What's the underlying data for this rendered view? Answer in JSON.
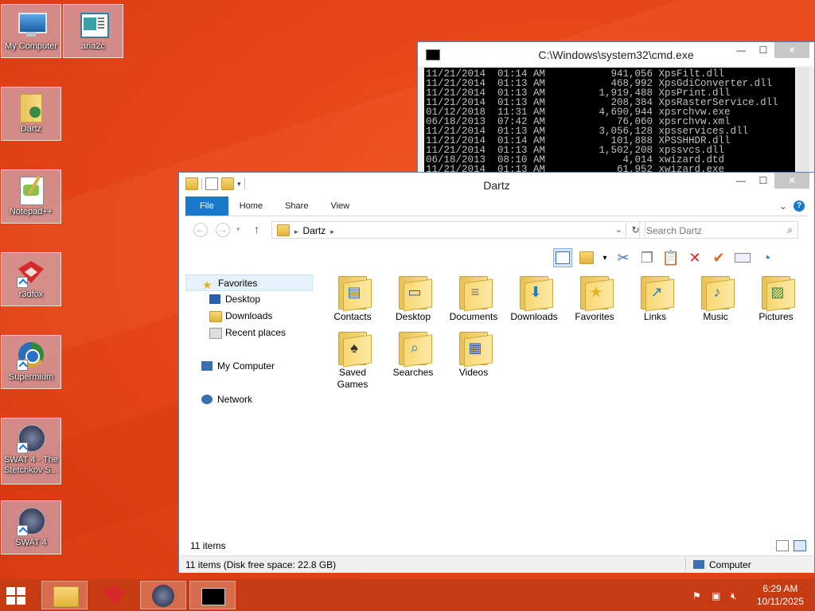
{
  "desktop": {
    "icons": [
      {
        "label": "My Computer"
      },
      {
        "label": "aria2c"
      },
      {
        "label": "Dartz"
      },
      {
        "label": "Notepad++"
      },
      {
        "label": "r3dfox"
      },
      {
        "label": "Supermium"
      },
      {
        "label": "SWAT 4 - The Stetchkov S..."
      },
      {
        "label": "SWAT 4"
      }
    ]
  },
  "cmd": {
    "title": "C:\\Windows\\system32\\cmd.exe",
    "lines": [
      "11/21/2014  01:14 AM           941,056 XpsFilt.dll",
      "11/21/2014  01:13 AM           468,992 XpsGdiConverter.dll",
      "11/21/2014  01:13 AM         1,919,488 XpsPrint.dll",
      "11/21/2014  01:13 AM           208,384 XpsRasterService.dll",
      "01/12/2018  11:31 AM         4,690,944 xpsrchvw.exe",
      "06/18/2013  07:42 AM            76,060 xpsrchvw.xml",
      "11/21/2014  01:13 AM         3,056,128 xpsservices.dll",
      "11/21/2014  01:14 AM           101,888 XPSSHHDR.dll",
      "11/21/2014  01:13 AM         1,502,208 xpssvcs.dll",
      "06/18/2013  08:10 AM             4,014 xwizard.dtd",
      "11/21/2014  01:13 AM            61,952 xwizard.exe"
    ]
  },
  "explorer": {
    "title": "Dartz",
    "tabs": {
      "file": "File",
      "home": "Home",
      "share": "Share",
      "view": "View"
    },
    "address": {
      "path": "Dartz"
    },
    "search": {
      "placeholder": "Search Dartz"
    },
    "nav": {
      "favorites": "Favorites",
      "desktop": "Desktop",
      "downloads": "Downloads",
      "recent": "Recent places",
      "computer": "My Computer",
      "network": "Network"
    },
    "folders": [
      {
        "label": "Contacts",
        "icon": "contacts-icon",
        "glyph": "▤"
      },
      {
        "label": "Desktop",
        "icon": "desktop-icon",
        "glyph": "▭"
      },
      {
        "label": "Documents",
        "icon": "documents-icon",
        "glyph": "≡"
      },
      {
        "label": "Downloads",
        "icon": "downloads-icon",
        "glyph": "⬇"
      },
      {
        "label": "Favorites",
        "icon": "star-icon",
        "glyph": "★"
      },
      {
        "label": "Links",
        "icon": "link-arrow-icon",
        "glyph": "↗"
      },
      {
        "label": "Music",
        "icon": "music-note-icon",
        "glyph": "♪"
      },
      {
        "label": "Pictures",
        "icon": "picture-icon",
        "glyph": "▨"
      },
      {
        "label": "Saved Games",
        "icon": "chess-icon",
        "glyph": "♠"
      },
      {
        "label": "Searches",
        "icon": "magnifier-icon",
        "glyph": "⌕"
      },
      {
        "label": "Videos",
        "icon": "film-icon",
        "glyph": "▦"
      }
    ],
    "item_count": "11 items",
    "status_left": "11 items (Disk free space: 22.8 GB)",
    "status_right": "Computer"
  },
  "taskbar": {
    "time": "6:29 AM",
    "date": "10/11/2025"
  },
  "colors": {
    "desktop": "#e8461a",
    "taskbar": "#c63b12",
    "file_tab": "#1979ca"
  }
}
